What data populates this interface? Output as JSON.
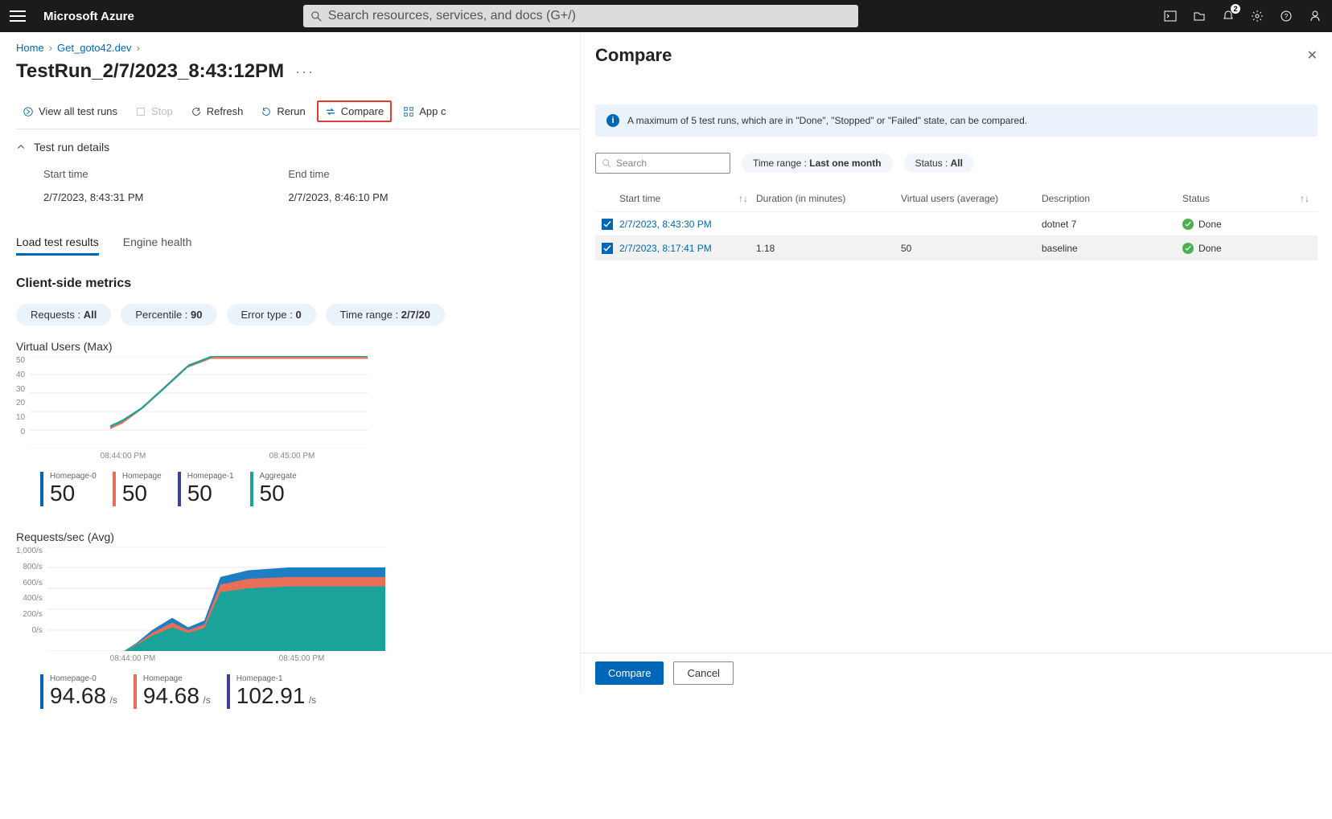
{
  "topbar": {
    "brand": "Microsoft Azure",
    "search_placeholder": "Search resources, services, and docs (G+/)",
    "notif_badge": "2"
  },
  "breadcrumbs": {
    "b1": "Home",
    "b2": "Get_goto42.dev"
  },
  "title": "TestRun_2/7/2023_8:43:12PM",
  "toolbar": {
    "view_all": "View all test runs",
    "stop": "Stop",
    "refresh": "Refresh",
    "rerun": "Rerun",
    "compare": "Compare",
    "app": "App c"
  },
  "acc": {
    "label": "Test run details"
  },
  "details": {
    "start_lbl": "Start time",
    "start_val": "2/7/2023, 8:43:31 PM",
    "end_lbl": "End time",
    "end_val": "2/7/2023, 8:46:10 PM"
  },
  "tabs": {
    "t1": "Load test results",
    "t2": "Engine health"
  },
  "csm": {
    "heading": "Client-side metrics"
  },
  "pills": {
    "req": "Requests : ",
    "req_v": "All",
    "pct": "Percentile : ",
    "pct_v": "90",
    "err": "Error type : ",
    "err_v": "0",
    "tr": "Time range : ",
    "tr_v": "2/7/20"
  },
  "chart1": {
    "title": "Virtual Users (Max)",
    "x1": "08:44:00 PM",
    "x2": "08:45:00 PM",
    "legend": [
      {
        "name": "Homepage-0",
        "value": "50",
        "color": "#0067b8"
      },
      {
        "name": "Homepage",
        "value": "50",
        "color": "#e86e58"
      },
      {
        "name": "Homepage-1",
        "value": "50",
        "color": "#3b3fa0"
      },
      {
        "name": "Aggregate",
        "value": "50",
        "color": "#1aa39a"
      }
    ]
  },
  "chart2": {
    "title": "Requests/sec (Avg)",
    "x1": "08:44:00 PM",
    "x2": "08:45:00 PM",
    "legend": [
      {
        "name": "Homepage-0",
        "value": "94.68",
        "unit": "/s",
        "color": "#0067b8"
      },
      {
        "name": "Homepage",
        "value": "94.68",
        "unit": "/s",
        "color": "#e86e58"
      },
      {
        "name": "Homepage-1",
        "value": "102.91",
        "unit": "/s",
        "color": "#3b3fa0"
      }
    ]
  },
  "chart_data": [
    {
      "type": "line",
      "title": "Virtual Users (Max)",
      "ylim": [
        0,
        50
      ],
      "yticks": [
        0,
        10,
        20,
        30,
        40,
        50
      ],
      "x_labels": [
        "08:44:00 PM",
        "08:45:00 PM"
      ],
      "series": [
        {
          "name": "Homepage-0",
          "values": [
            12,
            15,
            22,
            33,
            45,
            50,
            50,
            50,
            50
          ]
        },
        {
          "name": "Homepage",
          "values": [
            12,
            15,
            22,
            33,
            45,
            50,
            50,
            50,
            50
          ]
        },
        {
          "name": "Homepage-1",
          "values": [
            12,
            15,
            22,
            33,
            45,
            50,
            50,
            50,
            50
          ]
        },
        {
          "name": "Aggregate",
          "values": [
            12,
            15,
            22,
            33,
            45,
            50,
            50,
            50,
            50
          ]
        }
      ]
    },
    {
      "type": "area",
      "title": "Requests/sec (Avg)",
      "ylim": [
        0,
        1000
      ],
      "yticks": [
        0,
        200,
        400,
        600,
        800,
        1000
      ],
      "ytick_labels": [
        "0/s",
        "200/s",
        "400/s",
        "600/s",
        "800/s",
        "1,000/s"
      ],
      "x_labels": [
        "08:44:00 PM",
        "08:45:00 PM"
      ],
      "series": [
        {
          "name": "Homepage-0",
          "values": [
            0,
            40,
            120,
            180,
            120,
            160,
            550,
            580,
            600,
            600
          ]
        },
        {
          "name": "Homepage",
          "values": [
            0,
            40,
            120,
            180,
            120,
            160,
            550,
            580,
            600,
            600
          ]
        },
        {
          "name": "Homepage-1",
          "values": [
            0,
            45,
            130,
            195,
            130,
            175,
            600,
            630,
            650,
            650
          ]
        }
      ]
    }
  ],
  "panel": {
    "title": "Compare",
    "info": "A maximum of 5 test runs, which are in \"Done\", \"Stopped\" or \"Failed\" state, can be compared.",
    "search_placeholder": "Search",
    "time_pill_lbl": "Time range : ",
    "time_pill_v": "Last one month",
    "status_pill_lbl": "Status : ",
    "status_pill_v": "All",
    "cols": {
      "start": "Start time",
      "dur": "Duration (in minutes)",
      "vu": "Virtual users (average)",
      "desc": "Description",
      "status": "Status"
    },
    "rows": [
      {
        "start": "2/7/2023, 8:43:30 PM",
        "dur": "",
        "vu": "",
        "desc": "dotnet 7",
        "status": "Done"
      },
      {
        "start": "2/7/2023, 8:17:41 PM",
        "dur": "1.18",
        "vu": "50",
        "desc": "baseline",
        "status": "Done"
      }
    ],
    "btn_compare": "Compare",
    "btn_cancel": "Cancel"
  }
}
